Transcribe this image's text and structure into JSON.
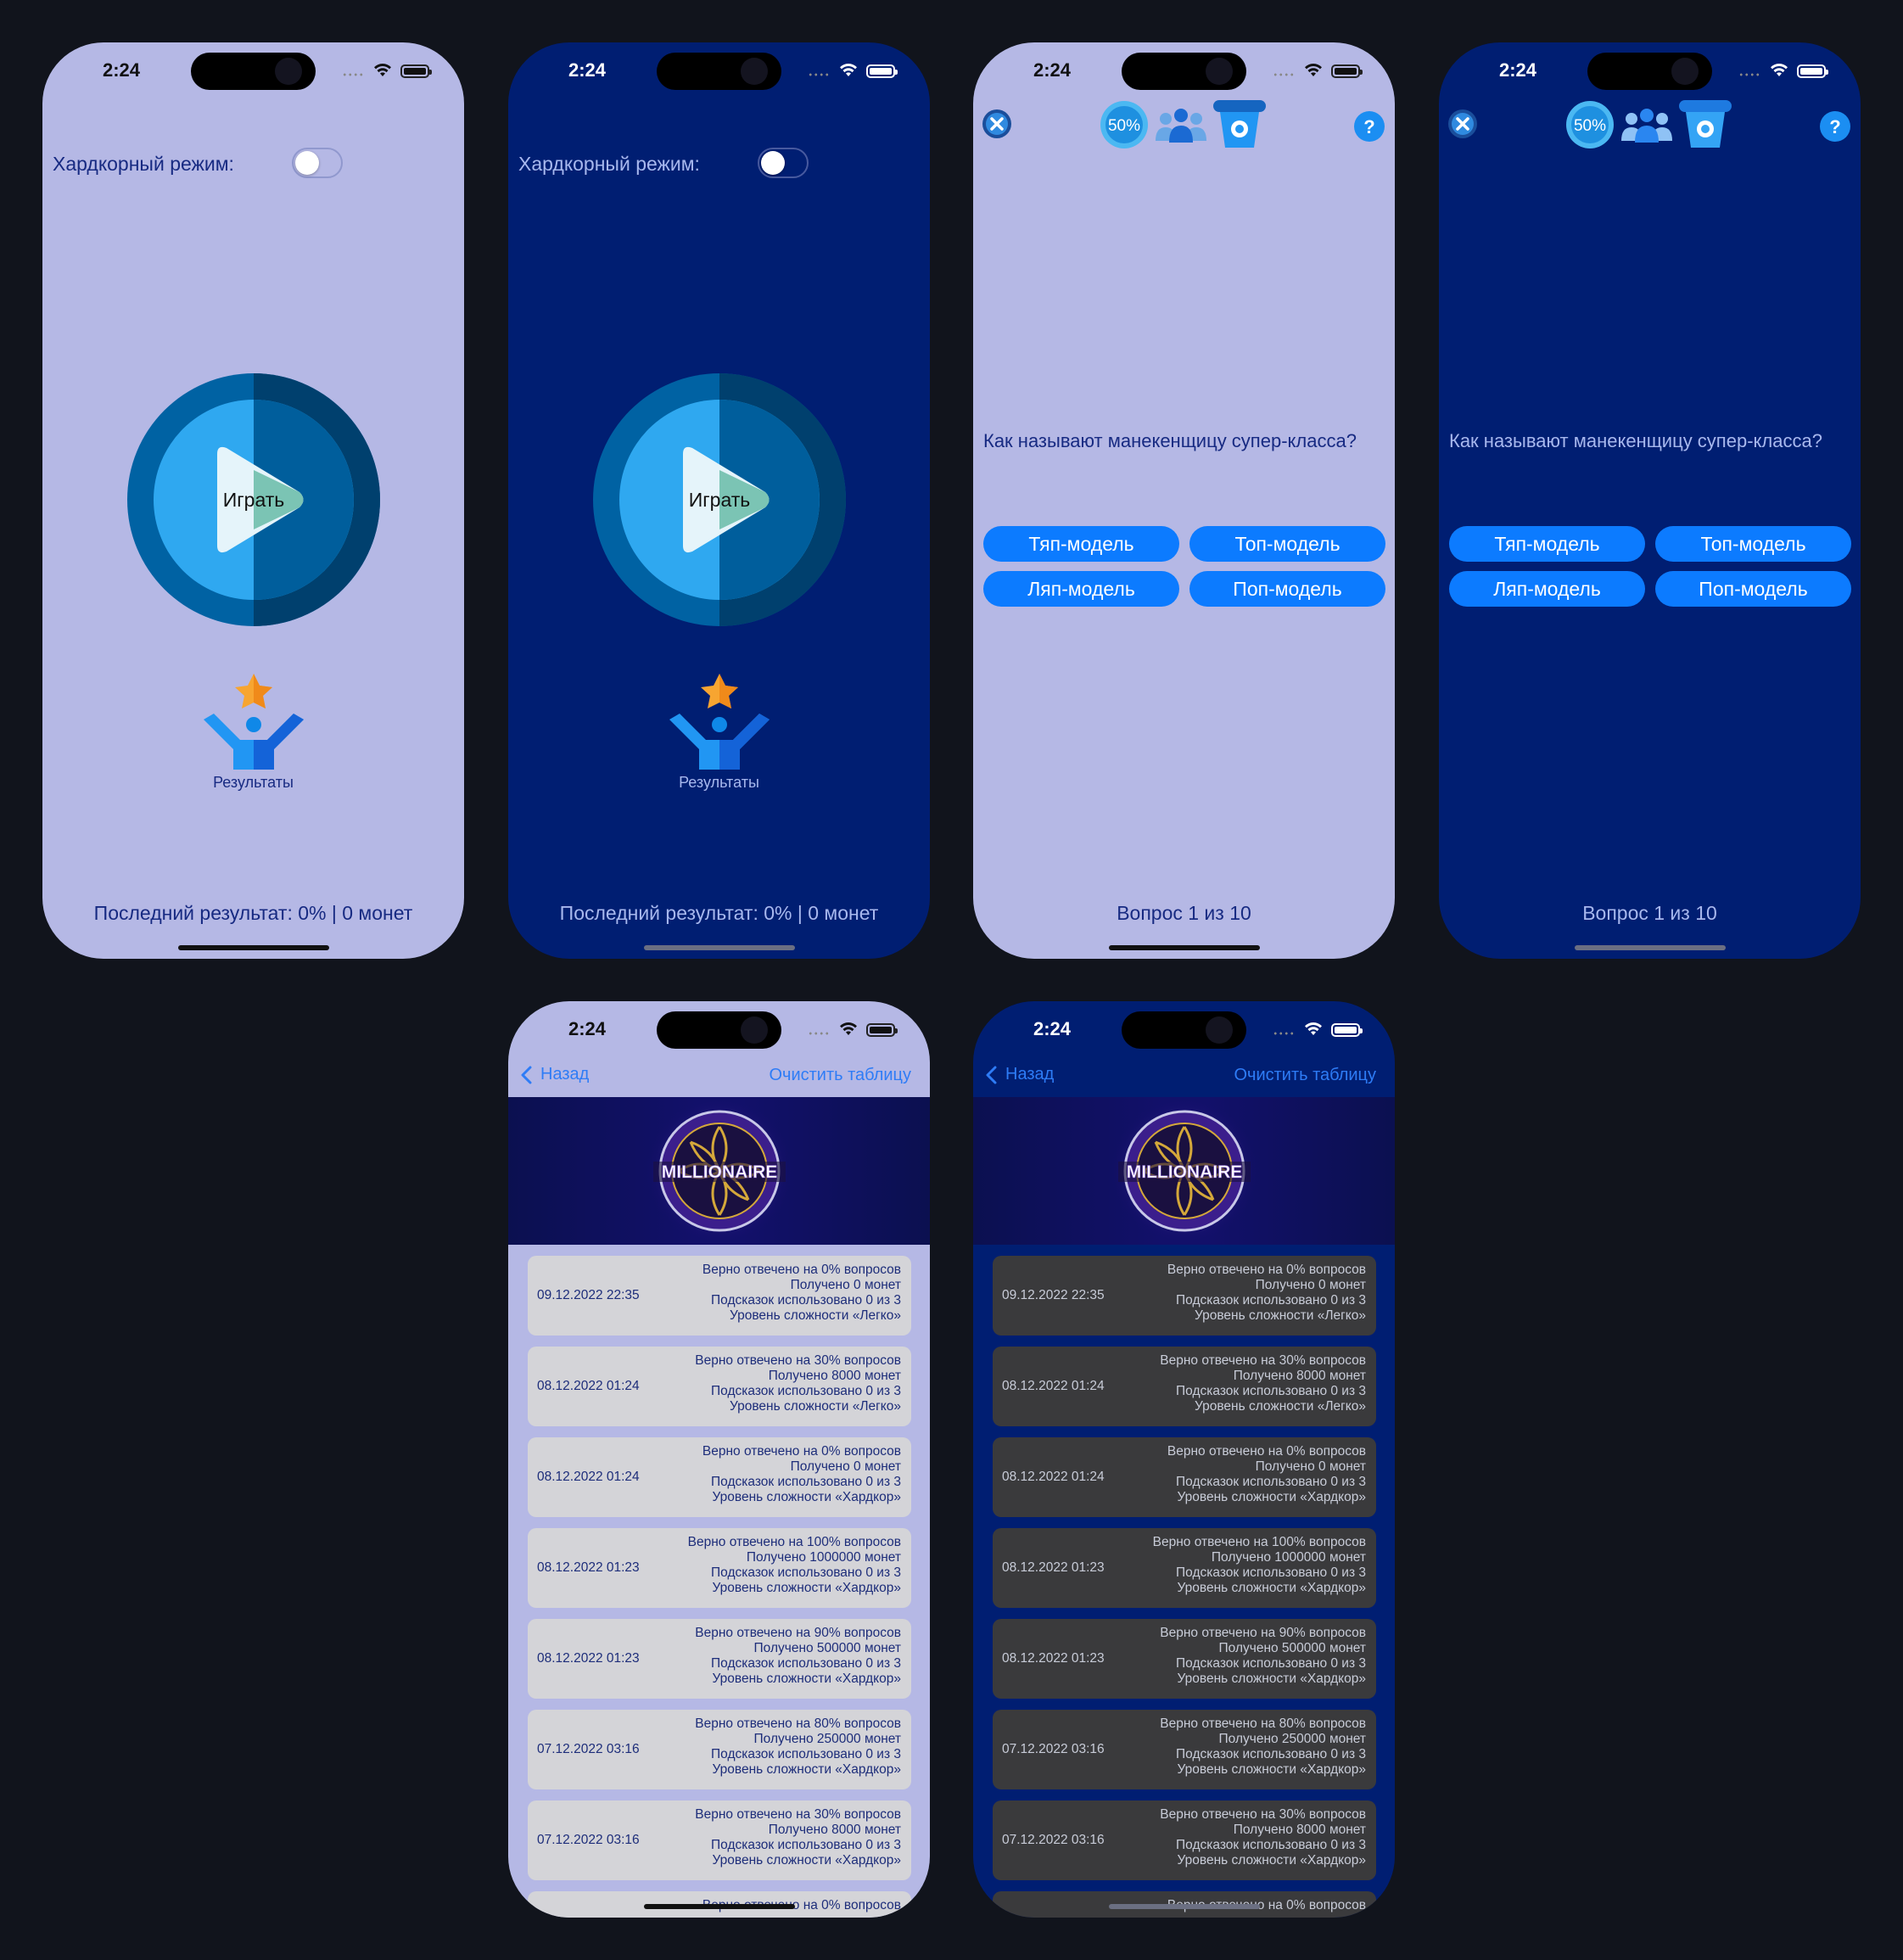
{
  "status": {
    "time": "2:24"
  },
  "start": {
    "hardcore_label": "Хардкорный режим:",
    "play_label": "Играть",
    "results_label": "Результаты",
    "last_result": "Последний результат: 0% | 0 монет"
  },
  "game": {
    "fifty_label": "50%",
    "question": "Как называют манекенщицу супер-класса?",
    "answers": [
      "Тяп-модель",
      "Топ-модель",
      "Ляп-модель",
      "Поп-модель"
    ],
    "progress": "Вопрос 1 из 10"
  },
  "results": {
    "back_label": "Назад",
    "clear_label": "Очистить таблицу",
    "logo_text": "MILLIONAIRE",
    "rows": [
      {
        "date": "09.12.2022 22:35",
        "line1": "Верно отвечено на 0% вопросов",
        "line2": "Получено 0 монет",
        "line3": "Подсказок использовано 0 из 3",
        "line4": "Уровень сложности «Легко»"
      },
      {
        "date": "08.12.2022 01:24",
        "line1": "Верно отвечено на 30% вопросов",
        "line2": "Получено 8000 монет",
        "line3": "Подсказок использовано 0 из 3",
        "line4": "Уровень сложности «Легко»"
      },
      {
        "date": "08.12.2022 01:24",
        "line1": "Верно отвечено на 0% вопросов",
        "line2": "Получено 0 монет",
        "line3": "Подсказок использовано 0 из 3",
        "line4": "Уровень сложности «Хардкор»"
      },
      {
        "date": "08.12.2022 01:23",
        "line1": "Верно отвечено на 100% вопросов",
        "line2": "Получено 1000000 монет",
        "line3": "Подсказок использовано 0 из 3",
        "line4": "Уровень сложности «Хардкор»"
      },
      {
        "date": "08.12.2022 01:23",
        "line1": "Верно отвечено на 90% вопросов",
        "line2": "Получено 500000 монет",
        "line3": "Подсказок использовано 0 из 3",
        "line4": "Уровень сложности «Хардкор»"
      },
      {
        "date": "07.12.2022 03:16",
        "line1": "Верно отвечено на 80% вопросов",
        "line2": "Получено 250000 монет",
        "line3": "Подсказок использовано 0 из 3",
        "line4": "Уровень сложности «Хардкор»"
      },
      {
        "date": "07.12.2022 03:16",
        "line1": "Верно отвечено на 30% вопросов",
        "line2": "Получено 8000 монет",
        "line3": "Подсказок использовано 0 из 3",
        "line4": "Уровень сложности «Хардкор»"
      }
    ],
    "partial_row": {
      "line1": "Верно отвечено на 0% вопросов"
    }
  },
  "colors": {
    "light_bg": "#b5b8e5",
    "dark_bg": "#001e72",
    "accent": "#0c7bff",
    "page_bg": "#11141c"
  },
  "icons": [
    "play-icon",
    "results-person-star-icon",
    "close-icon",
    "fifty-fifty-icon",
    "audience-icon",
    "phone-icon",
    "help-icon",
    "chevron-left-icon",
    "millionaire-logo"
  ]
}
